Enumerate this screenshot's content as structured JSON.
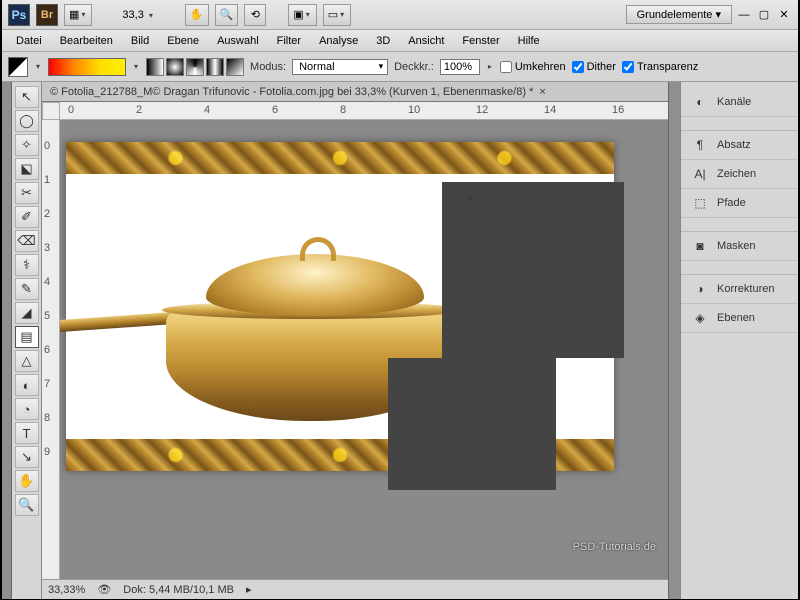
{
  "app": {
    "zoom_display": "33,3",
    "workspace": "Grundelemente"
  },
  "menus": [
    "Datei",
    "Bearbeiten",
    "Bild",
    "Ebene",
    "Auswahl",
    "Filter",
    "Analyse",
    "3D",
    "Ansicht",
    "Fenster",
    "Hilfe"
  ],
  "options": {
    "mode_label": "Modus:",
    "mode_value": "Normal",
    "opacity_label": "Deckkr.:",
    "opacity_value": "100%",
    "invert_label": "Umkehren",
    "dither_label": "Dither",
    "transparency_label": "Transparenz",
    "invert_checked": false,
    "dither_checked": true,
    "transparency_checked": true
  },
  "document": {
    "tab_title": "© Fotolia_212788_M© Dragan Trifunovic - Fotolia.com.jpg bei 33,3% (Kurven 1, Ebenenmaske/8) *"
  },
  "ruler_h": [
    "0",
    "2",
    "4",
    "6",
    "8",
    "10",
    "12",
    "14",
    "16"
  ],
  "ruler_v": [
    "0",
    "1",
    "2",
    "3",
    "4",
    "5",
    "6",
    "7",
    "8",
    "9"
  ],
  "status": {
    "zoom": "33,33%",
    "doc_info": "Dok: 5,44 MB/10,1 MB"
  },
  "watermark": "PSD-Tutorials.de",
  "panels": [
    "Kanäle",
    "Absatz",
    "Zeichen",
    "Pfade",
    "Masken",
    "Korrekturen",
    "Ebenen"
  ],
  "panel_icons": [
    "◐",
    "¶",
    "A|",
    "⬚",
    "◙",
    "◑",
    "◈"
  ],
  "tools": [
    "↖",
    "◯",
    "✧",
    "⬕",
    "✂",
    "✐",
    "⌫",
    "⚕",
    "✎",
    "◢",
    "▤",
    "△",
    "◐",
    "◔",
    "✎",
    "T",
    "↘",
    "✋",
    "🔍"
  ]
}
